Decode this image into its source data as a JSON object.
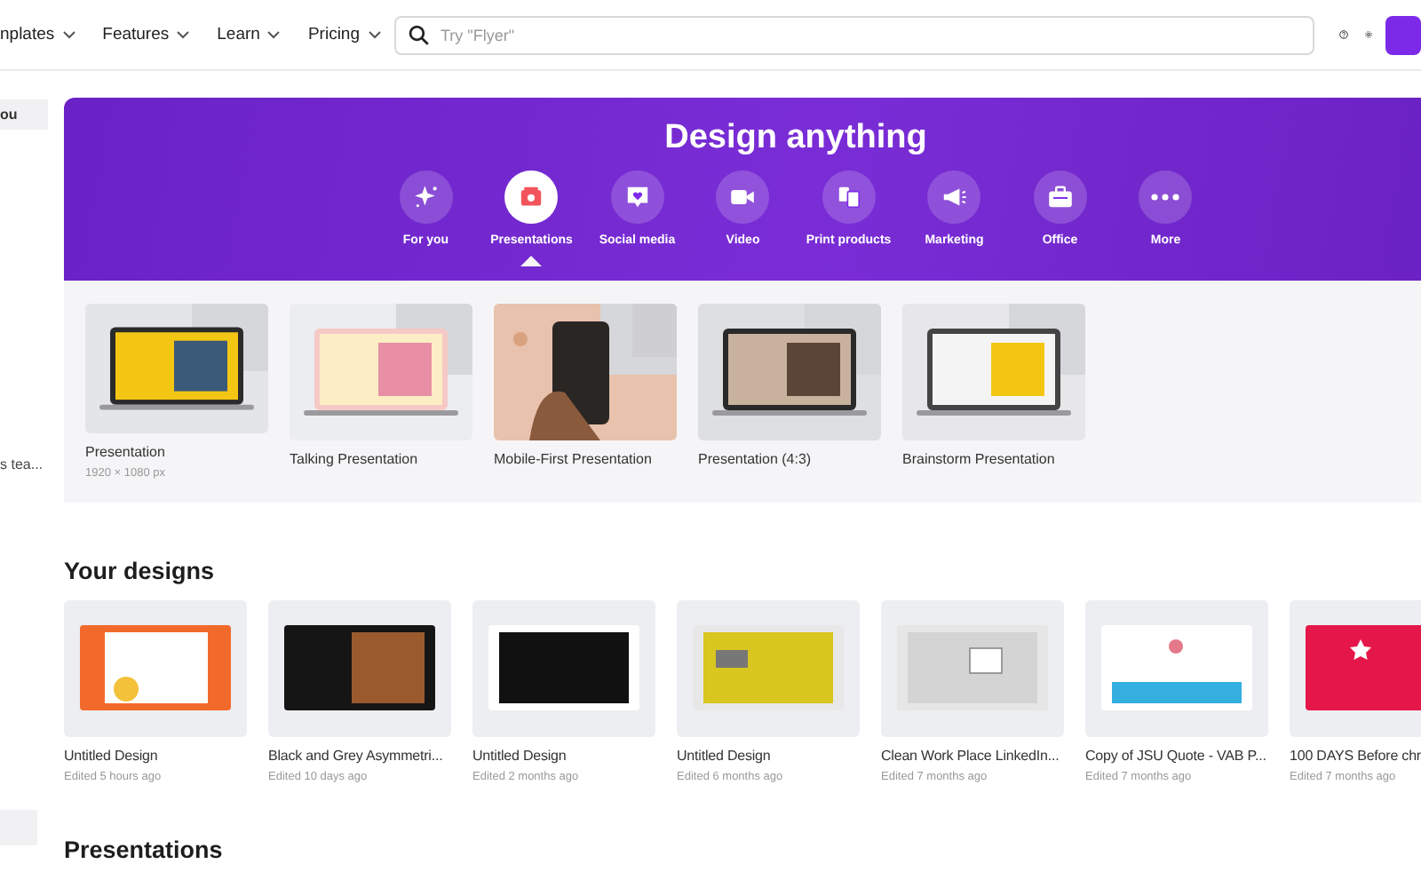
{
  "nav": {
    "items": [
      {
        "label": "nplates"
      },
      {
        "label": "Features"
      },
      {
        "label": "Learn"
      },
      {
        "label": "Pricing"
      }
    ],
    "search": {
      "placeholder": "Try \"Flyer\""
    }
  },
  "sidebar": {
    "items": [
      {
        "label": "ou",
        "selected": true
      },
      {
        "label": "s tea...",
        "selected": false
      }
    ]
  },
  "banner": {
    "title": "Design anything",
    "categories": [
      {
        "label": "For you",
        "selected": false
      },
      {
        "label": "Presentations",
        "selected": true
      },
      {
        "label": "Social media",
        "selected": false
      },
      {
        "label": "Video",
        "selected": false
      },
      {
        "label": "Print products",
        "selected": false
      },
      {
        "label": "Marketing",
        "selected": false
      },
      {
        "label": "Office",
        "selected": false
      },
      {
        "label": "More",
        "selected": false
      }
    ]
  },
  "templates": [
    {
      "title": "Presentation",
      "size": "1920 × 1080 px"
    },
    {
      "title": "Talking Presentation"
    },
    {
      "title": "Mobile-First Presentation"
    },
    {
      "title": "Presentation (4:3)"
    },
    {
      "title": "Brainstorm Presentation"
    }
  ],
  "your_designs": {
    "heading": "Your designs",
    "items": [
      {
        "title": "Untitled Design",
        "edited": "Edited 5 hours ago"
      },
      {
        "title": "Black and Grey Asymmetri...",
        "edited": "Edited 10 days ago"
      },
      {
        "title": "Untitled Design",
        "edited": "Edited 2 months ago"
      },
      {
        "title": "Untitled Design",
        "edited": "Edited 6 months ago"
      },
      {
        "title": "Clean Work Place LinkedIn...",
        "edited": "Edited 7 months ago"
      },
      {
        "title": "Copy of JSU Quote - VAB P...",
        "edited": "Edited 7 months ago"
      },
      {
        "title": "100 DAYS Before chr",
        "edited": "Edited 7 months ago"
      }
    ]
  },
  "presentations": {
    "heading": "Presentations"
  }
}
